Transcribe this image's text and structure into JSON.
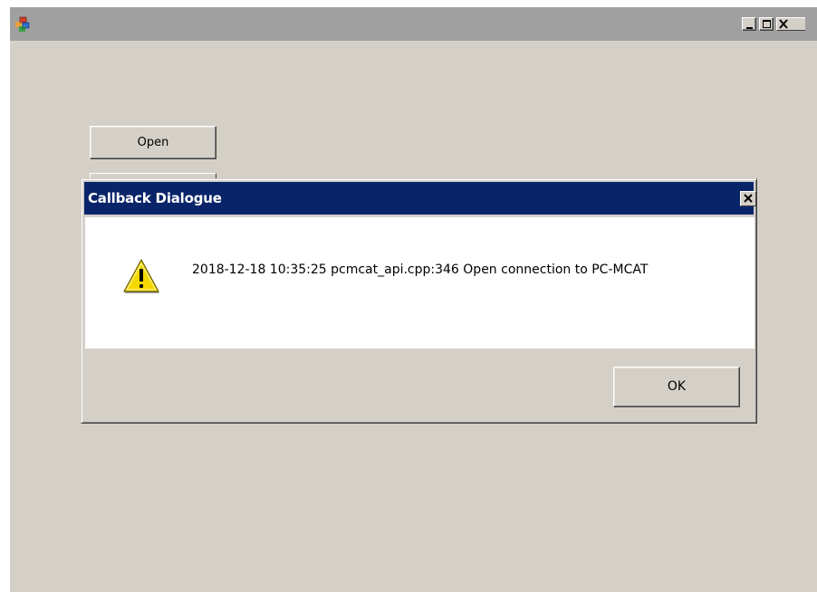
{
  "main_window": {
    "title": "",
    "app_icon": "application-cube-icon",
    "controls": [
      "minimize-icon",
      "maximize-icon",
      "close-icon"
    ],
    "buttons": {
      "open_label": "Open",
      "second_label": ""
    }
  },
  "dialog": {
    "title": "Callback Dialogue",
    "icon": "warning-icon",
    "message": "2018-12-18 10:35:25 pcmcat_api.cpp:346 Open connection to PC-MCAT",
    "ok_label": "OK"
  },
  "colors": {
    "dialog_titlebar": "#0a246a",
    "main_titlebar": "#a0a0a0",
    "face": "#d4d0c8",
    "warning_yellow": "#f5d800"
  }
}
